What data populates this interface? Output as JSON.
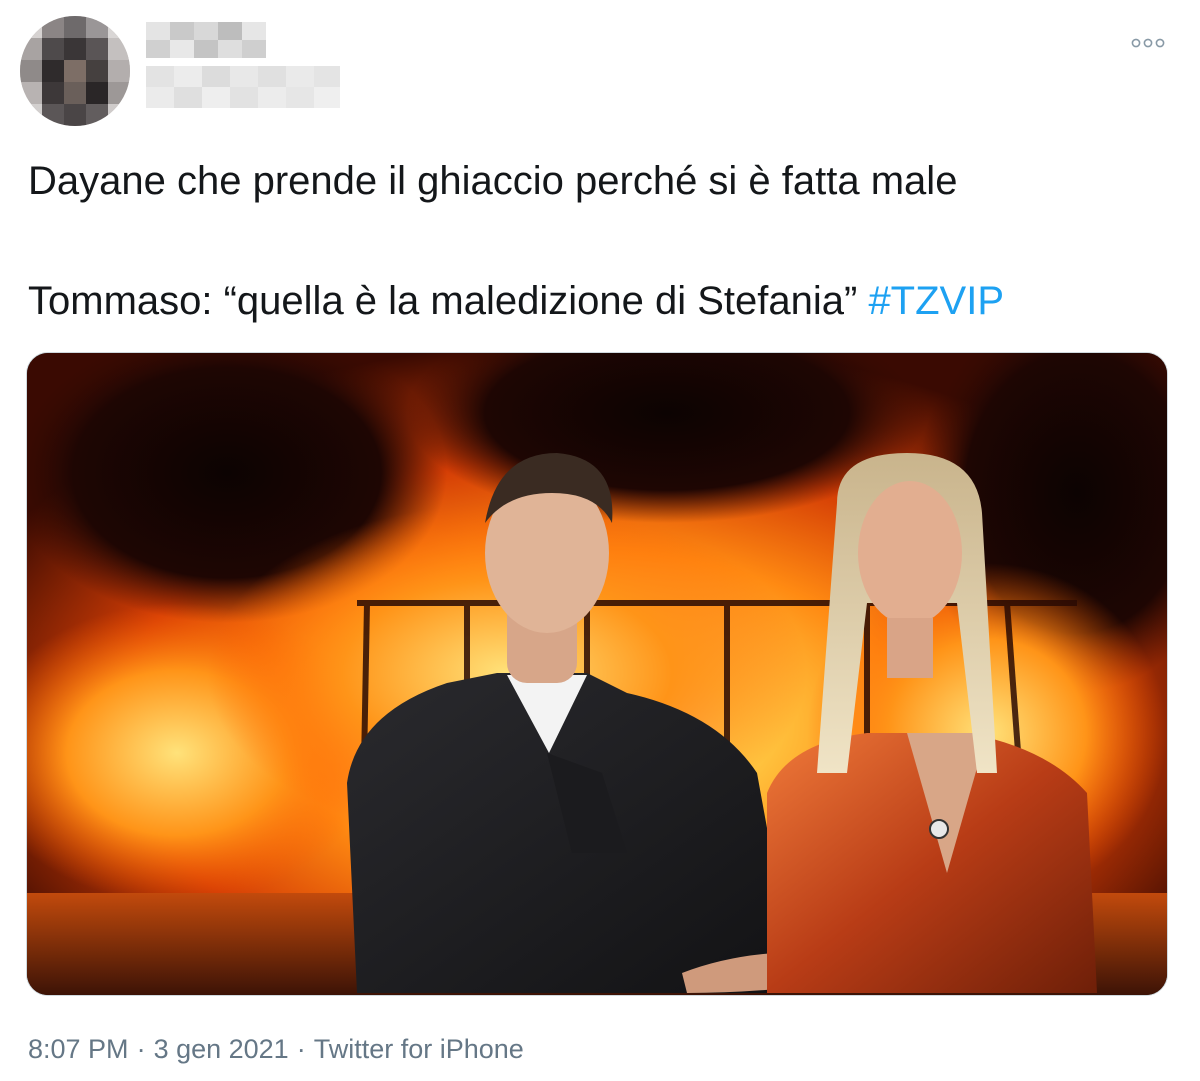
{
  "author": {
    "avatar": "blurred-avatar",
    "display_name": "",
    "handle": ""
  },
  "header": {
    "more_icon": "more-icon"
  },
  "tweet": {
    "line1": "Dayane che prende il ghiaccio perché si è fatta male",
    "line2_text": "Tommaso: “quella è la maledizione di Stefania” ",
    "hashtag": "#TZVIP"
  },
  "media": {
    "image": "burning-vehicle-with-two-people-photo"
  },
  "footer": {
    "time": "8:07 PM",
    "separator": "·",
    "date": "3 gen 2021",
    "source": "Twitter for iPhone"
  },
  "colors": {
    "text": "#14171a",
    "hashtag": "#1da1f2",
    "meta": "#657786",
    "border": "#cfd9de"
  }
}
